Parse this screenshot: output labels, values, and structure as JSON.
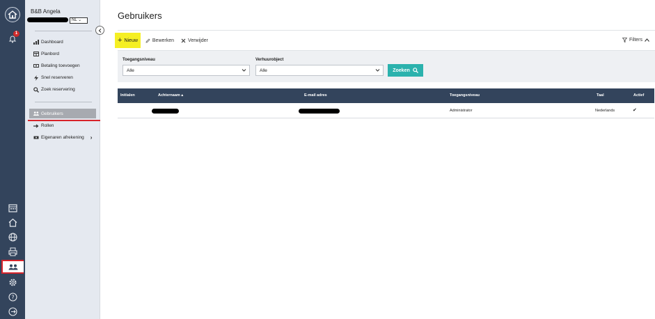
{
  "rail": {
    "icons": [
      "home-logo-icon",
      "bell-icon",
      "calendar-icon",
      "house-icon",
      "globe-icon",
      "printer-icon",
      "users-icon",
      "gear-icon",
      "help-icon",
      "logout-icon"
    ],
    "bell_badge": "1"
  },
  "sidebar": {
    "property_name": "B&B Angela",
    "language": "NL",
    "items": [
      {
        "label": "Dashboard",
        "icon": "chart-icon"
      },
      {
        "label": "Planbord",
        "icon": "calendar-grid-icon"
      },
      {
        "label": "Betaling toevoegen",
        "icon": "money-icon"
      },
      {
        "label": "Snel reserveren",
        "icon": "lightning-icon"
      },
      {
        "label": "Zoek reservering",
        "icon": "search-icon"
      },
      {
        "label": "Gebruikers",
        "icon": "users-icon",
        "active": true
      },
      {
        "label": "Rollen",
        "icon": "arrow-right-icon"
      },
      {
        "label": "Eigenaren afrekening",
        "icon": "money-icon"
      }
    ]
  },
  "main": {
    "title": "Gebruikers",
    "toolbar": {
      "new_label": "Nieuw",
      "edit_label": "Bewerken",
      "delete_label": "Verwijder",
      "filters_label": "Filters"
    },
    "filters": {
      "access_label": "Toegangsniveau",
      "access_value": "Alle",
      "object_label": "Verhuurobject",
      "object_value": "Alle",
      "search_label": "Zoeken"
    },
    "table": {
      "columns": [
        "Initialen",
        "Achternaam",
        "E-mail adres",
        "Toegangsniveau",
        "Taal",
        "Actief"
      ],
      "rows": [
        {
          "initials": "",
          "lastname": "",
          "email": "",
          "access": "Administrator",
          "language": "Nederlands",
          "active": "✔"
        }
      ]
    }
  },
  "colors": {
    "rail": "#33445c",
    "sidebar": "#e5e9f0",
    "accent_teal": "#2bb2ad",
    "highlight_yellow": "#f5ef24",
    "annotation_red": "#d8232a"
  }
}
